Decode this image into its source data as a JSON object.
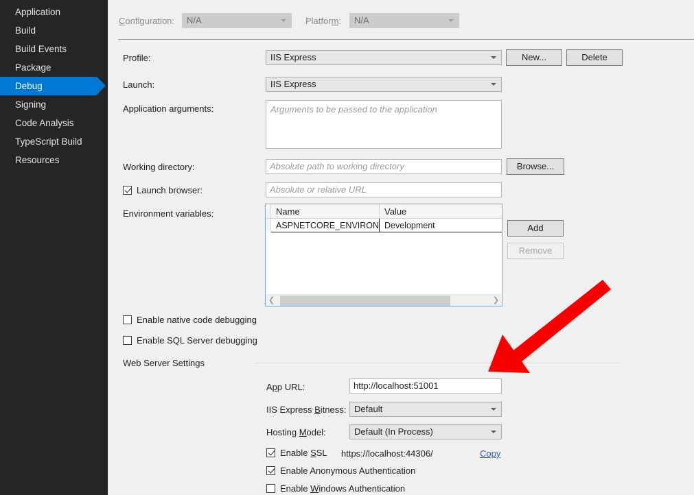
{
  "sidebar": {
    "items": [
      {
        "label": "Application",
        "selected": false
      },
      {
        "label": "Build",
        "selected": false
      },
      {
        "label": "Build Events",
        "selected": false
      },
      {
        "label": "Package",
        "selected": false
      },
      {
        "label": "Debug",
        "selected": true
      },
      {
        "label": "Signing",
        "selected": false
      },
      {
        "label": "Code Analysis",
        "selected": false
      },
      {
        "label": "TypeScript Build",
        "selected": false
      },
      {
        "label": "Resources",
        "selected": false
      }
    ]
  },
  "top_bar": {
    "configuration_label": "Configuration:",
    "configuration_value": "N/A",
    "platform_label": "Platform:",
    "platform_value": "N/A"
  },
  "profile_row": {
    "label": "Profile:",
    "value": "IIS Express",
    "new_button": "New...",
    "delete_button": "Delete"
  },
  "launch_row": {
    "label": "Launch:",
    "value": "IIS Express"
  },
  "app_arguments": {
    "label": "Application arguments:",
    "placeholder": "Arguments to be passed to the application",
    "value": ""
  },
  "working_directory": {
    "label": "Working directory:",
    "placeholder": "Absolute path to working directory",
    "value": "",
    "browse_button": "Browse..."
  },
  "launch_browser": {
    "label": "Launch browser:",
    "checked": true,
    "placeholder": "Absolute or relative URL",
    "value": ""
  },
  "environment_variables": {
    "label": "Environment variables:",
    "columns": [
      "Name",
      "Value"
    ],
    "rows": [
      {
        "name": "ASPNETCORE_ENVIRONMENT",
        "value": "Development"
      }
    ],
    "add_button": "Add",
    "remove_button": "Remove",
    "remove_enabled": false,
    "scroll_left_icon": "chevron-left-icon",
    "scroll_right_icon": "chevron-right-icon"
  },
  "debug_options": {
    "native_code": {
      "label": "Enable native code debugging",
      "checked": false
    },
    "sql_server": {
      "label": "Enable SQL Server debugging",
      "checked": false
    }
  },
  "web_server_settings": {
    "section_title": "Web Server Settings",
    "app_url": {
      "label": "App URL:",
      "value": "http://localhost:51001"
    },
    "bitness": {
      "label": "IIS Express Bitness:",
      "value": "Default"
    },
    "hosting_model": {
      "label": "Hosting Model:",
      "value": "Default (In Process)"
    },
    "enable_ssl": {
      "label": "Enable SSL",
      "checked": true,
      "url": "https://localhost:44306/",
      "copy_link": "Copy"
    },
    "enable_anonymous_auth": {
      "label": "Enable Anonymous Authentication",
      "checked": true
    },
    "enable_windows_auth": {
      "label": "Enable Windows Authentication",
      "checked": false
    }
  },
  "annotation": {
    "arrow_color": "#f90000",
    "name": "red-arrow-annotation"
  },
  "colors": {
    "sidebar_bg": "#252526",
    "selection_blue": "#0078d4",
    "content_bg": "#f0f0f0",
    "link_blue": "#1867c0",
    "grid_border": "#7fa2c8"
  }
}
